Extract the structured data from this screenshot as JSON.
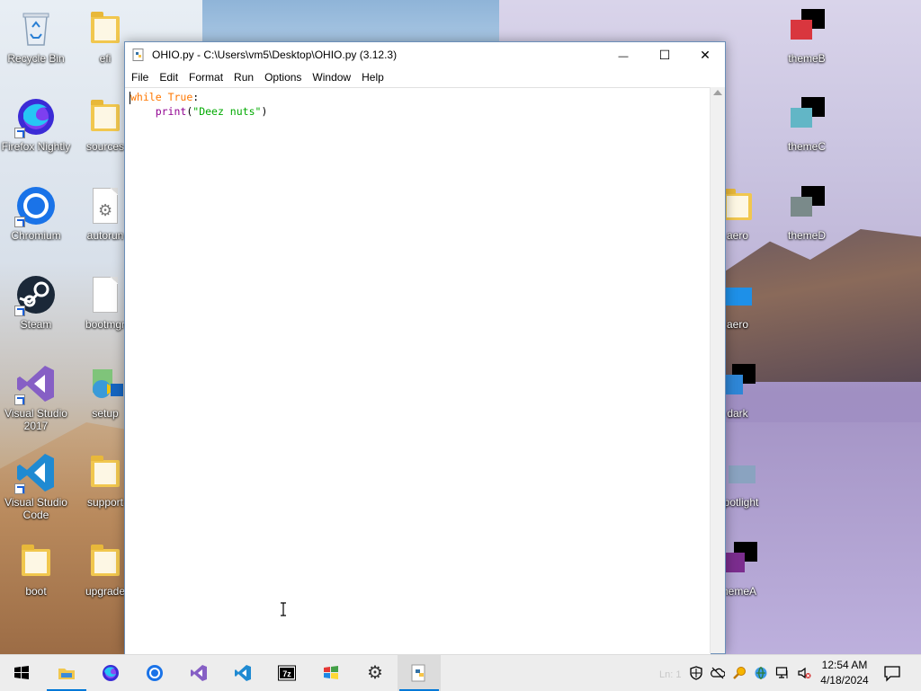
{
  "desktop": {
    "icons_left": [
      {
        "label": "Recycle Bin"
      },
      {
        "label": "Firefox Nightly"
      },
      {
        "label": "Chromium"
      },
      {
        "label": "Steam"
      },
      {
        "label": "Visual Studio 2017"
      },
      {
        "label": "Visual Studio Code"
      },
      {
        "label": "boot"
      }
    ],
    "icons_col2": [
      {
        "label": "efi"
      },
      {
        "label": "sources"
      },
      {
        "label": "autorun"
      },
      {
        "label": "bootmgr"
      },
      {
        "label": "setup"
      },
      {
        "label": "support"
      },
      {
        "label": "upgrade"
      }
    ],
    "icons_right_partial": [
      {
        "label": "aero"
      },
      {
        "label": "aero"
      },
      {
        "label": "dark"
      },
      {
        "label": "potlight"
      },
      {
        "label": "hemeA"
      }
    ],
    "icons_right": [
      {
        "label": "themeB"
      },
      {
        "label": "themeC"
      },
      {
        "label": "themeD"
      }
    ]
  },
  "window": {
    "title": "OHIO.py - C:\\Users\\vm5\\Desktop\\OHIO.py (3.12.3)",
    "minimize_glyph": "—",
    "maximize_glyph": "☐",
    "close_glyph": "✕",
    "menu": [
      "File",
      "Edit",
      "Format",
      "Run",
      "Options",
      "Window",
      "Help"
    ],
    "code": {
      "line1_kw": "while",
      "line1_rest": " ",
      "line1_true": "True",
      "line1_colon": ":",
      "line2_indent": "    ",
      "line2_func": "print",
      "line2_open": "(",
      "line2_str": "\"Deez nuts\"",
      "line2_close": ")"
    }
  },
  "taskbar": {
    "apps": [
      "start",
      "file-explorer",
      "firefox-nightly",
      "chromium",
      "visual-studio",
      "vscode",
      "7zip",
      "windows-logo-app",
      "settings",
      "python-idle"
    ],
    "watermark": "Ln: 1",
    "clock_time": "12:54 AM",
    "clock_date": "4/18/2024"
  },
  "colors": {
    "keyword": "#ff7700",
    "builtin": "#900090",
    "string": "#00aa00",
    "accent": "#0078d7"
  }
}
